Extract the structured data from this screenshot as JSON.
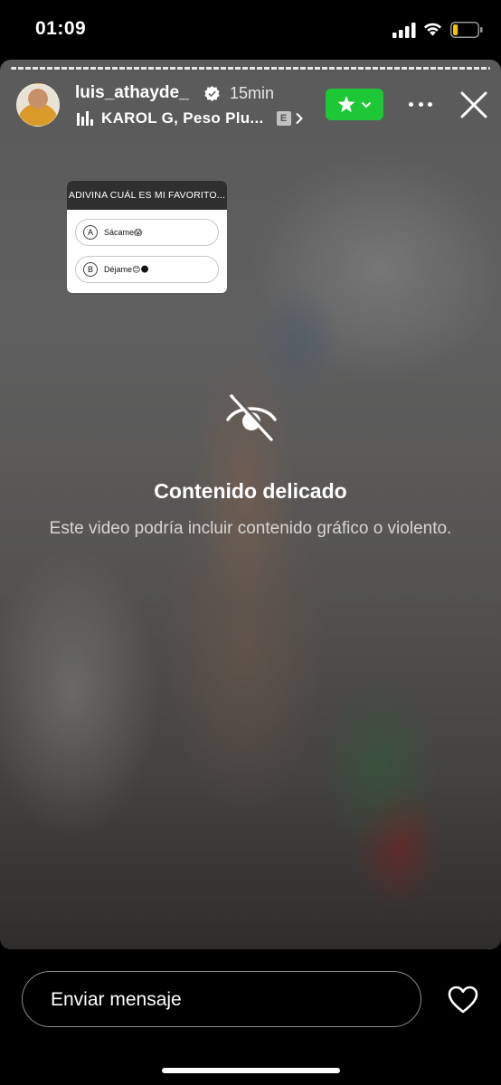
{
  "status_bar": {
    "time": "01:09",
    "battery_level": 0.2,
    "battery_color": "#f5c400"
  },
  "story": {
    "username": "luis_athayde_",
    "time_ago": "15min",
    "music": "KAROL G, Peso Plu...",
    "explicit_badge": "E",
    "close_friends_color": "#1ec735",
    "icons": {
      "verified": "verified-badge-icon",
      "music": "music-bars-icon",
      "close_friends": "star-icon",
      "more": "more-dots-icon",
      "close": "close-icon"
    }
  },
  "quiz": {
    "title": "ADIVINA CUÁL ES MI FAVORITO...",
    "options": [
      {
        "letter": "A",
        "text": "Sácame😱"
      },
      {
        "letter": "B",
        "text": "Déjame😊🌑"
      }
    ]
  },
  "sensitive": {
    "title": "Contenido delicado",
    "description": "Este video podría incluir contenido gráfico o violento.",
    "icon": "eye-slash-icon"
  },
  "footer": {
    "message_placeholder": "Enviar mensaje",
    "like_icon": "heart-icon"
  }
}
